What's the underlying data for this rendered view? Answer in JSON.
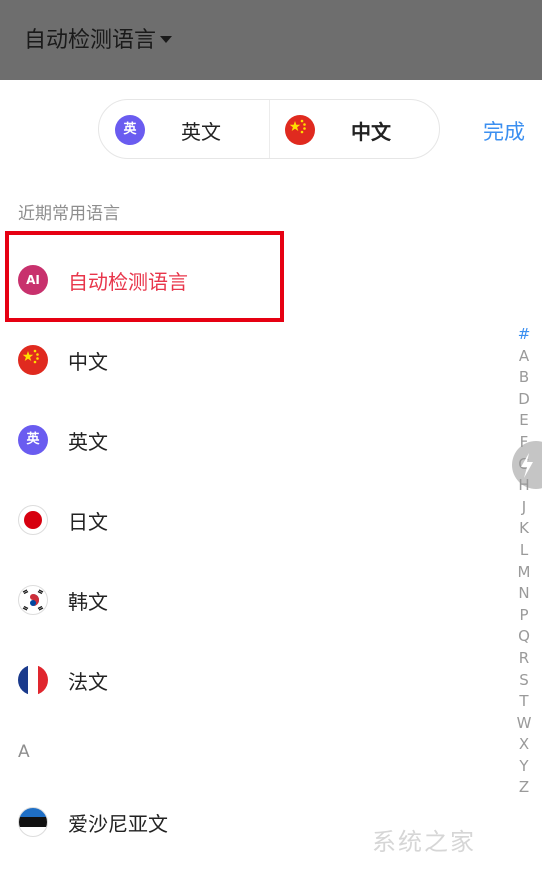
{
  "topbar": {
    "title": "自动检测语言"
  },
  "switcher": {
    "source": {
      "label": "英文",
      "icon_text": "英",
      "icon": "english-badge"
    },
    "target": {
      "label": "中文",
      "icon": "china-flag"
    },
    "done_label": "完成"
  },
  "sections": {
    "recent_header": "近期常用语言",
    "a_header": "A"
  },
  "recent_languages": [
    {
      "name": "自动检测语言",
      "icon": "ai-badge",
      "icon_text": "AI",
      "selected": true
    },
    {
      "name": "中文",
      "icon": "china-flag"
    },
    {
      "name": "英文",
      "icon": "english-badge",
      "icon_text": "英"
    },
    {
      "name": "日文",
      "icon": "japan-flag"
    },
    {
      "name": "韩文",
      "icon": "korea-flag"
    },
    {
      "name": "法文",
      "icon": "france-flag"
    }
  ],
  "a_languages": [
    {
      "name": "爱沙尼亚文",
      "icon": "estonia-flag"
    }
  ],
  "index_bar": [
    "#",
    "A",
    "B",
    "D",
    "E",
    "F",
    "G",
    "H",
    "J",
    "K",
    "L",
    "M",
    "N",
    "P",
    "Q",
    "R",
    "S",
    "T",
    "W",
    "X",
    "Y",
    "Z"
  ],
  "watermark": "系统之家",
  "colors": {
    "accent": "#3b8ff0",
    "selected_text": "#e8354a",
    "highlight_border": "#e60012",
    "topbar_bg": "#6e6e6e"
  }
}
